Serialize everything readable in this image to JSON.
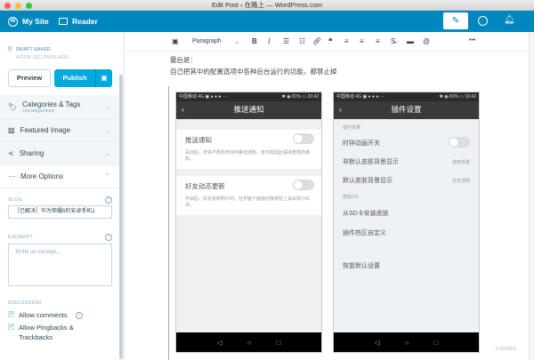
{
  "window": {
    "title": "Edit Post ‹ 在路上 — WordPress.com"
  },
  "masthead": {
    "my_site": "My Site",
    "reader": "Reader"
  },
  "sidebar": {
    "status": "DRAFT SAVED",
    "status_time": "A FEW SECONDS AGO",
    "preview": "Preview",
    "publish": "Publish",
    "categories": {
      "label": "Categories & Tags",
      "sub": "Uncategorized"
    },
    "featured": "Featured Image",
    "sharing": "Sharing",
    "more": "More Options",
    "slug_label": "SLUG",
    "slug_value": "［已解决］华为荣耀6的安卓手机1",
    "excerpt_label": "EXCERPT",
    "excerpt_placeholder": "Write an excerpt...",
    "discussion_label": "DISCUSSION",
    "allow_comments": "Allow comments",
    "allow_pingbacks": "Allow Pingbacks & Trackbacks"
  },
  "toolbar": {
    "format": "Paragraph",
    "bold": "B",
    "italic": "I",
    "more": "•••"
  },
  "content": {
    "line1": "最后是：",
    "line2": "自己把其中的配置选项中各种后台运行的功能，都禁止掉",
    "word_count": "6 WORDS"
  },
  "phone1": {
    "status_left": "中国移动 4G ▣ ● ● ● ···",
    "status_right": "✱ ◉ 81% ▭ 10:42",
    "title": "推送通知",
    "item1": "推送通知",
    "desc1": "关闭后，您将不再收到任何推送通知，有可能因此漏掉重要的通知。",
    "item2": "好友动态更新",
    "desc2": "开启后，好友有新照片时，在界面下面我切换按钮上会出现小红点。"
  },
  "phone2": {
    "status_left": "中国移动 4G ▣ ● ● ● ···",
    "status_right": "✱ ◉ 81% ▭ 10:42",
    "title": "插件设置",
    "sec1": "插件效果",
    "item1": "时钟动画开关",
    "item2": "非默认皮肤背景显示",
    "val2": "使用背景",
    "item3": "默认皮肤背景显示",
    "val3": "完全透明",
    "sec2": "皮肤DIY",
    "item4": "从SD卡安装皮肤",
    "item5": "插件热区自定义",
    "item6": "恢复默认设置"
  },
  "colors": {
    "brand": "#0087be",
    "publish": "#00aadc"
  }
}
